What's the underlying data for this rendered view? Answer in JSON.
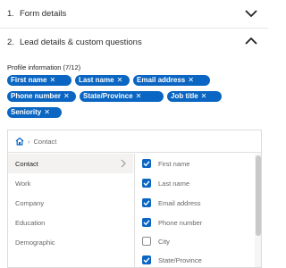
{
  "sections": [
    {
      "number": "1.",
      "title": "Form details",
      "state": "collapsed"
    },
    {
      "number": "2.",
      "title": "Lead details & custom questions",
      "state": "expanded"
    }
  ],
  "profile_info_label": "Profile information (7/12)",
  "chips": [
    "First name",
    "Last name",
    "Email address",
    "Phone number",
    "State/Province",
    "Job title",
    "Seniority"
  ],
  "chip_remove_glyph": "✕",
  "breadcrumb": {
    "current": "Contact",
    "separator": "›"
  },
  "categories": [
    "Contact",
    "Work",
    "Company",
    "Education",
    "Demographic"
  ],
  "active_category": "Contact",
  "options": [
    {
      "label": "First name",
      "checked": true
    },
    {
      "label": "Last name",
      "checked": true
    },
    {
      "label": "Email address",
      "checked": true
    },
    {
      "label": "Phone number",
      "checked": true
    },
    {
      "label": "City",
      "checked": false
    },
    {
      "label": "State/Province",
      "checked": true
    }
  ],
  "colors": {
    "accent": "#0a66c2",
    "panel_border": "#dcdcdc",
    "active_bg": "#f3f2f0"
  }
}
